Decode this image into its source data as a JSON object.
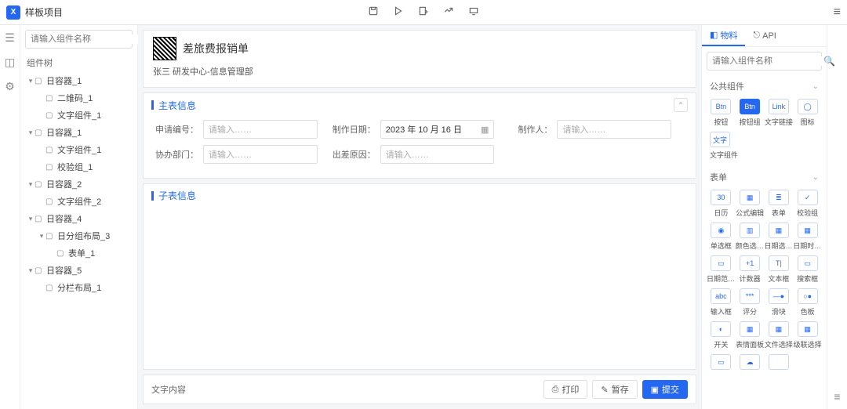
{
  "header": {
    "project": "样板项目"
  },
  "left": {
    "searchPlaceholder": "请输入组件名称",
    "outlineTitle": "组件树",
    "tree": [
      {
        "l": 0,
        "caret": "▾",
        "label": "日容器_1"
      },
      {
        "l": 1,
        "caret": "",
        "label": "二维码_1"
      },
      {
        "l": 1,
        "caret": "",
        "label": "文字组件_1"
      },
      {
        "l": 0,
        "caret": "▾",
        "label": "日容器_1"
      },
      {
        "l": 1,
        "caret": "",
        "label": "文字组件_1"
      },
      {
        "l": 1,
        "caret": "",
        "label": "校验组_1"
      },
      {
        "l": 0,
        "caret": "▾",
        "label": "日容器_2"
      },
      {
        "l": 1,
        "caret": "",
        "label": "文字组件_2"
      },
      {
        "l": 0,
        "caret": "▾",
        "label": "日容器_4"
      },
      {
        "l": 1,
        "caret": "▾",
        "label": "日分组布局_3"
      },
      {
        "l": 2,
        "caret": "",
        "label": "表单_1"
      },
      {
        "l": 0,
        "caret": "▾",
        "label": "日容器_5"
      },
      {
        "l": 1,
        "caret": "",
        "label": "分栏布局_1"
      }
    ]
  },
  "canvas": {
    "title": "差旅费报销单",
    "subtitle": "张三 研发中心-信息管理部",
    "sec1": "主表信息",
    "sec2": "子表信息",
    "fields": {
      "orderNo": {
        "label": "申请编号：",
        "ph": "请输入……"
      },
      "date": {
        "label": "制作日期：",
        "value": "2023 年 10 月 16 日"
      },
      "person": {
        "label": "制作人：",
        "ph": "请输入……"
      },
      "dept": {
        "label": "协办部门：",
        "ph": "请输入……"
      },
      "reason": {
        "label": "出差原因：",
        "ph": "请输入……"
      }
    },
    "footerLabel": "文字内容",
    "actions": {
      "print": "打印",
      "draft": "暂存",
      "submit": "提交"
    }
  },
  "right": {
    "tabs": {
      "widgets": "物料",
      "api": "API"
    },
    "searchPlaceholder": "请输入组件名称",
    "cat1": "公共组件",
    "cat2": "表单",
    "common": [
      {
        "ico": "Btn",
        "label": "按钮",
        "fill": false
      },
      {
        "ico": "Btn",
        "label": "按钮组",
        "fill": true
      },
      {
        "ico": "Link",
        "label": "文字链接",
        "fill": false
      },
      {
        "ico": "◯",
        "label": "图标",
        "fill": false
      },
      {
        "ico": "文字",
        "label": "文字组件",
        "fill": false,
        "wide": true
      }
    ],
    "form": [
      {
        "ico": "30",
        "label": "日历"
      },
      {
        "ico": "▦",
        "label": "公式编辑"
      },
      {
        "ico": "≣",
        "label": "表单"
      },
      {
        "ico": "✓",
        "label": "校验组"
      },
      {
        "ico": "◉",
        "label": "单选框"
      },
      {
        "ico": "▥",
        "label": "颜色选择器"
      },
      {
        "ico": "▦",
        "label": "日期选择器"
      },
      {
        "ico": "▦",
        "label": "日期时间…"
      },
      {
        "ico": "▭",
        "label": "日期范围…"
      },
      {
        "ico": "+1",
        "label": "计数器"
      },
      {
        "ico": "T|",
        "label": "文本框"
      },
      {
        "ico": "▭",
        "label": "搜索框"
      },
      {
        "ico": "abc",
        "label": "输入框"
      },
      {
        "ico": "***",
        "label": "评分"
      },
      {
        "ico": "—●",
        "label": "滑块"
      },
      {
        "ico": "○●",
        "label": "色板"
      },
      {
        "ico": "◐",
        "label": "开关"
      },
      {
        "ico": "▦",
        "label": "表情面板"
      },
      {
        "ico": "▦",
        "label": "文件选择"
      },
      {
        "ico": "▦",
        "label": "级联选择"
      },
      {
        "ico": "▭",
        "label": ""
      },
      {
        "ico": "☁",
        "label": ""
      },
      {
        "ico": "</>",
        "label": ""
      }
    ]
  }
}
